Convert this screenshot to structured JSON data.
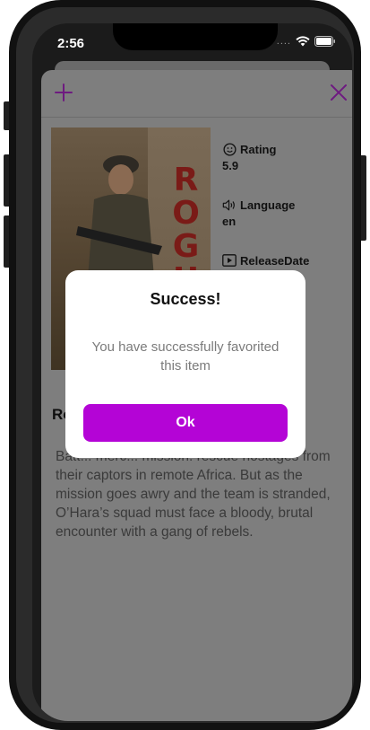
{
  "status_bar": {
    "time": "2:56",
    "signal": "....",
    "wifi_icon": "wifi-icon",
    "battery_icon": "battery-icon"
  },
  "nav": {
    "add_icon": "plus-icon",
    "close_icon": "close-icon",
    "accent_color": "#b404d6"
  },
  "poster": {
    "title_letters": "ROGU"
  },
  "details": {
    "rating_label": "Rating",
    "rating_value": "5.9",
    "language_label": "Language",
    "language_value": "en",
    "release_label": "ReleaseDate"
  },
  "movie": {
    "title": "Rog",
    "overview": "Batt... merc... mission: rescue hostages from their captors in remote Africa. But as the mission goes awry and the team is stranded, O’Hara’s squad must face a bloody, brutal encounter with a gang of rebels."
  },
  "dialog": {
    "title": "Success!",
    "message": "You have successfully favorited this item",
    "ok_label": "Ok",
    "button_color": "#b404d6"
  }
}
